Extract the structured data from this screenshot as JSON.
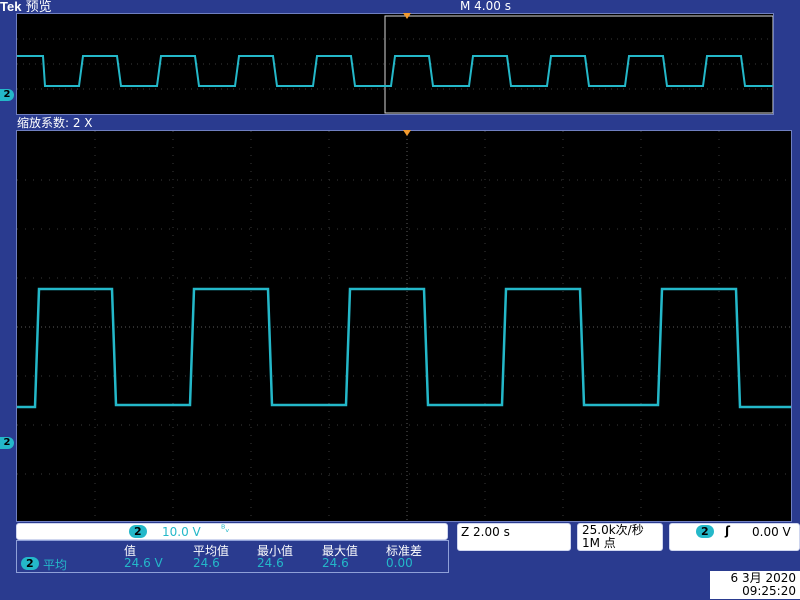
{
  "header": {
    "brand": "Tek",
    "mode": "预览",
    "timebase": "M 4.00 s"
  },
  "zoom": {
    "label": "缩放系数: 2 X"
  },
  "channel": {
    "number": "2",
    "color": "#24b8c9"
  },
  "channel_settings": {
    "scale": "10.0 V",
    "bandwidth_icon": "bandwidth-limit-icon"
  },
  "zoom_time": {
    "value": "Z 2.00 s"
  },
  "acquisition": {
    "rate": "25.0k次/秒",
    "record": "1M 点"
  },
  "trigger": {
    "level": "0.00 V",
    "slope_icon": "rising-edge-icon"
  },
  "measurement": {
    "channel_label": "平均",
    "headers": [
      "值",
      "平均值",
      "最小值",
      "最大值",
      "标准差"
    ],
    "values": [
      "24.6 V",
      "24.6",
      "24.6",
      "24.6",
      "0.00"
    ]
  },
  "datetime": {
    "date": "6 3月  2020",
    "time": "09:25:20"
  }
}
